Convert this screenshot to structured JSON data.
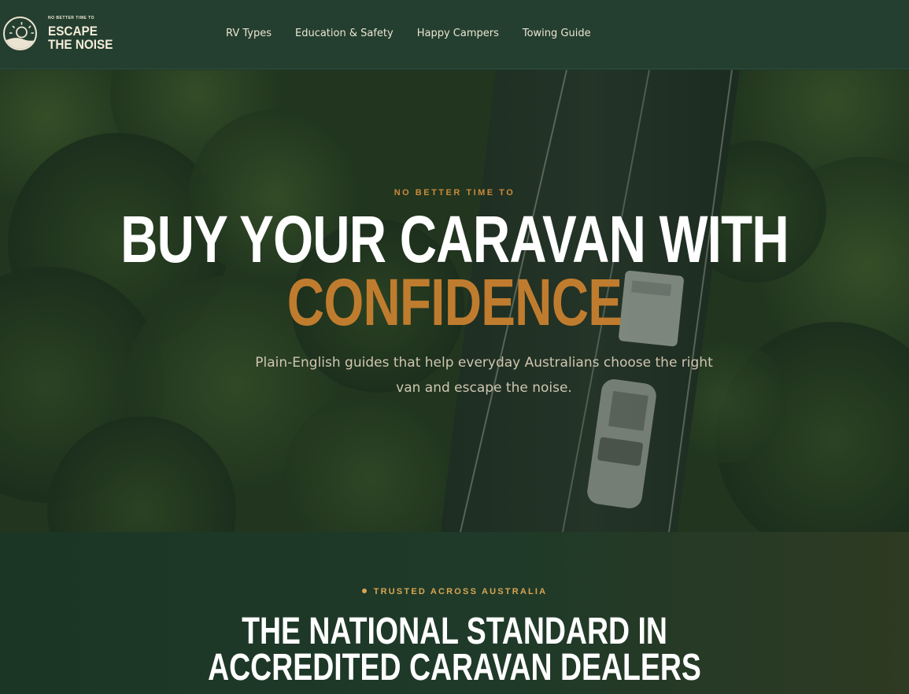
{
  "header": {
    "logo": {
      "tagline": "NO BETTER TIME TO",
      "line1": "ESCAPE",
      "line2": "THE NOISE",
      "icon": "sun-horizon-icon"
    },
    "nav": [
      {
        "label": "RV Types"
      },
      {
        "label": "Education & Safety"
      },
      {
        "label": "Happy Campers"
      },
      {
        "label": "Towing Guide"
      }
    ]
  },
  "hero": {
    "eyebrow": "NO BETTER TIME TO",
    "title_line1": "BUY YOUR CARAVAN WITH",
    "title_line2": "CONFIDENCE",
    "subtitle": "Plain-English guides that help everyday Australians choose the right van and escape the noise."
  },
  "trust": {
    "eyebrow": "TRUSTED ACROSS AUSTRALIA",
    "title_line1": "THE NATIONAL STANDARD IN",
    "title_line2": "ACCREDITED CARAVAN DEALERS"
  },
  "colors": {
    "header_bg": "#243f30",
    "accent_orange": "#c07c2e",
    "accent_gold": "#d8a552",
    "cream": "#ece4d2"
  }
}
